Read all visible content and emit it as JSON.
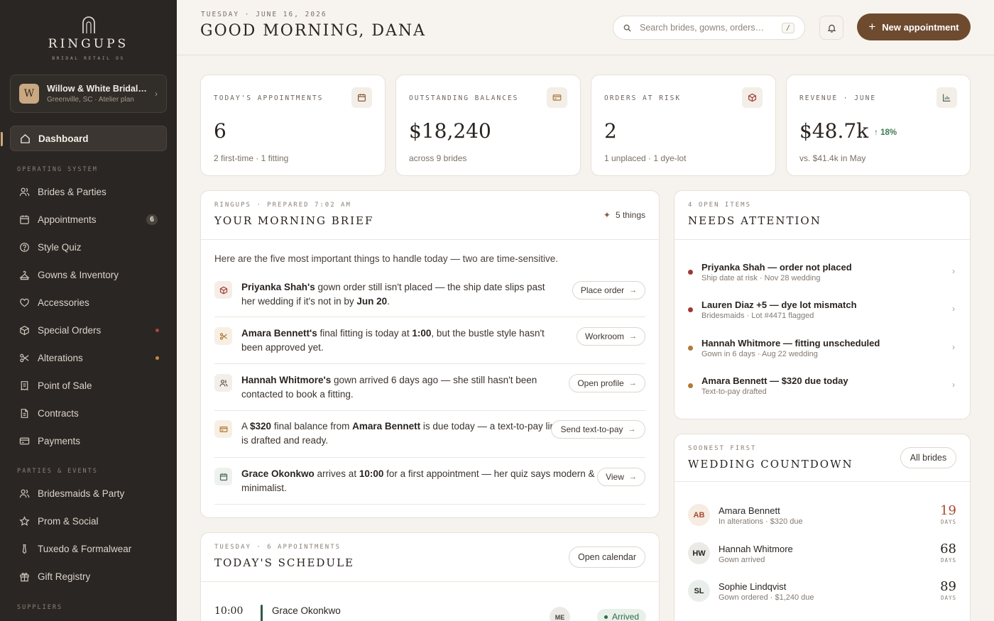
{
  "brand": {
    "name": "RINGUPS",
    "tagline": "BRIDAL RETAIL OS"
  },
  "store": {
    "initial": "W",
    "name": "Willow & White Bridal…",
    "plan": "Greenville, SC · Atelier plan"
  },
  "nav": {
    "active": "Dashboard",
    "sections": [
      {
        "label": "OPERATING SYSTEM"
      },
      {
        "label": "PARTIES & EVENTS"
      },
      {
        "label": "SUPPLIERS"
      }
    ],
    "items": [
      {
        "label": "Brides & Parties",
        "icon": "users-icon"
      },
      {
        "label": "Appointments",
        "icon": "calendar-icon",
        "badge": "6"
      },
      {
        "label": "Style Quiz",
        "icon": "question-icon"
      },
      {
        "label": "Gowns & Inventory",
        "icon": "hanger-icon"
      },
      {
        "label": "Accessories",
        "icon": "heart-icon"
      },
      {
        "label": "Special Orders",
        "icon": "box-icon",
        "dot": "#b0443e"
      },
      {
        "label": "Alterations",
        "icon": "scissors-icon",
        "dot": "#c98a3a"
      },
      {
        "label": "Point of Sale",
        "icon": "receipt-icon"
      },
      {
        "label": "Contracts",
        "icon": "document-icon"
      },
      {
        "label": "Payments",
        "icon": "card-icon"
      },
      {
        "label": "Bridesmaids & Party",
        "icon": "users-icon"
      },
      {
        "label": "Prom & Social",
        "icon": "star-icon"
      },
      {
        "label": "Tuxedo & Formalwear",
        "icon": "tie-icon"
      },
      {
        "label": "Gift Registry",
        "icon": "gift-icon"
      }
    ]
  },
  "header": {
    "date": "TUESDAY · JUNE 16, 2026",
    "greeting": "GOOD MORNING, DANA",
    "search_placeholder": "Search brides, gowns, orders…",
    "search_shortcut": "/",
    "new_appointment": "New appointment"
  },
  "stats": [
    {
      "label": "TODAY'S APPOINTMENTS",
      "value": "6",
      "sub": "2 first-time · 1 fitting",
      "icon": "calendar-icon"
    },
    {
      "label": "OUTSTANDING BALANCES",
      "value": "$18,240",
      "sub": "across 9 brides",
      "icon": "card-icon"
    },
    {
      "label": "ORDERS AT RISK",
      "value": "2",
      "sub": "1 unplaced · 1 dye-lot",
      "icon": "box-icon"
    },
    {
      "label": "REVENUE · JUNE",
      "value": "$48.7k",
      "delta": "↑ 18%",
      "sub": "vs. $41.4k in May",
      "icon": "chart-icon"
    }
  ],
  "brief": {
    "kicker": "RINGUPS · PREPARED 7:02 AM",
    "title": "YOUR MORNING BRIEF",
    "count": "5 things",
    "intro": "Here are the five most important things to handle today — two are time-sensitive.",
    "items": [
      {
        "icon": "box-icon",
        "action": "Place order"
      },
      {
        "icon": "scissors-icon",
        "action": "Workroom"
      },
      {
        "icon": "users-icon",
        "action": "Open profile"
      },
      {
        "icon": "card-icon",
        "action": "Send text-to-pay"
      },
      {
        "icon": "calendar-icon",
        "action": "View"
      }
    ]
  },
  "attention": {
    "kicker": "4 OPEN ITEMS",
    "title": "NEEDS ATTENTION",
    "items": [
      {
        "title": "Priyanka Shah — order not placed",
        "sub": "Ship date at risk · Nov 28 wedding",
        "color": "#9c3b33"
      },
      {
        "title": "Lauren Diaz +5 — dye lot mismatch",
        "sub": "Bridesmaids · Lot #4471 flagged",
        "color": "#9c3b33"
      },
      {
        "title": "Hannah Whitmore — fitting unscheduled",
        "sub": "Gown in 6 days · Aug 22 wedding",
        "color": "#b07a36"
      },
      {
        "title": "Amara Bennett — $320 due today",
        "sub": "Text-to-pay drafted",
        "color": "#b07a36"
      }
    ]
  },
  "countdown": {
    "kicker": "SOONEST FIRST",
    "title": "WEDDING COUNTDOWN",
    "button": "All brides",
    "unit": "DAYS",
    "items": [
      {
        "initials": "AB",
        "name": "Amara Bennett",
        "sub": "In alterations · $320 due",
        "days": "19",
        "color": "#a64a32",
        "bg": "#f6ece2"
      },
      {
        "initials": "HW",
        "name": "Hannah Whitmore",
        "sub": "Gown arrived",
        "days": "68",
        "color": "#2a2420",
        "bg": "#eceae6"
      },
      {
        "initials": "SL",
        "name": "Sophie Lindqvist",
        "sub": "Gown ordered · $1,240 due",
        "days": "89",
        "color": "#2a2420",
        "bg": "#eaeeea"
      }
    ]
  },
  "schedule": {
    "kicker": "TUESDAY · 6 APPOINTMENTS",
    "title": "TODAY'S SCHEDULE",
    "button": "Open calendar",
    "rows": [
      {
        "time": "10:00",
        "name": "Grace Okonkwo",
        "initials": "ME",
        "status": "Arrived"
      }
    ]
  }
}
